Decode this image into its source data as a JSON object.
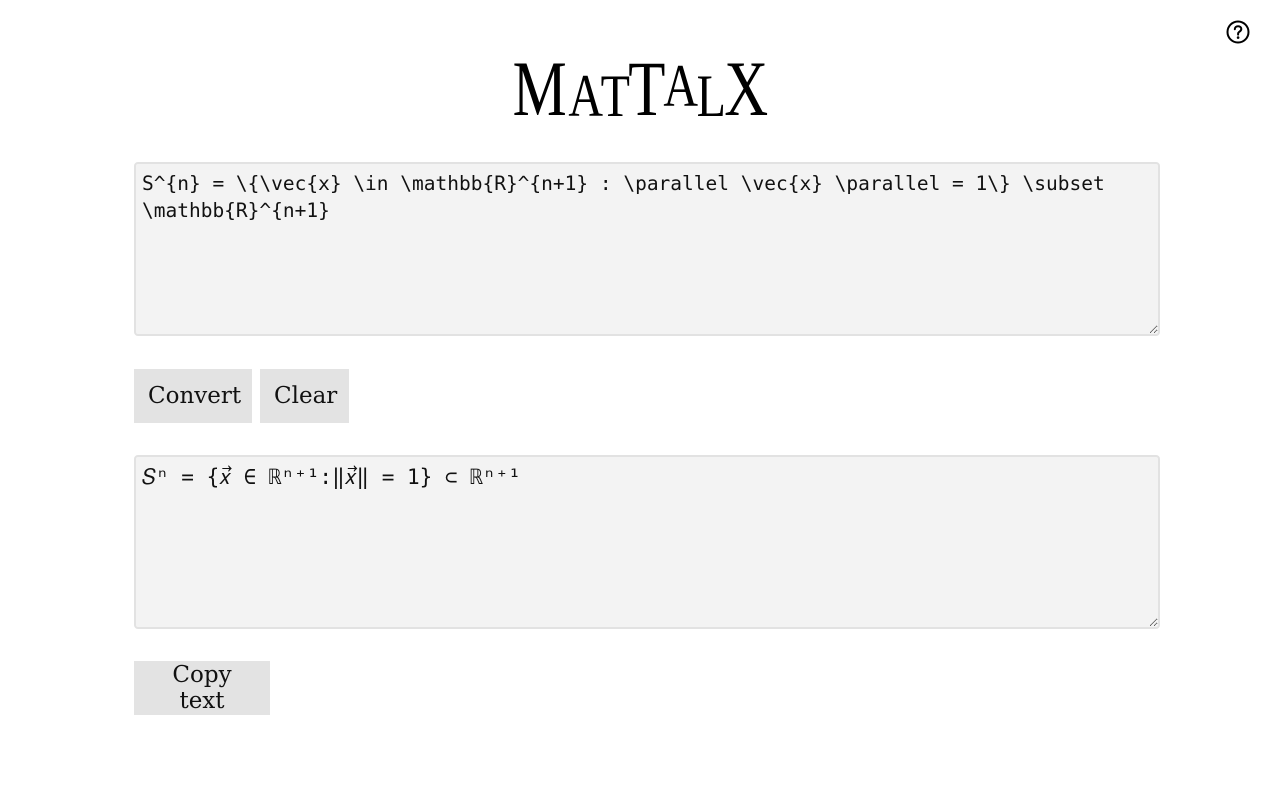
{
  "app": {
    "logo_letters": [
      "M",
      "A",
      "T",
      "T",
      "A",
      "L",
      "X"
    ],
    "help_icon": "question-circle-icon"
  },
  "input": {
    "value": "S^{n} = \\{\\vec{x} \\in \\mathbb{R}^{n+1} : \\parallel \\vec{x} \\parallel = 1\\} \\subset \\mathbb{R}^{n+1}"
  },
  "buttons": {
    "convert_label": "Convert",
    "clear_label": "Clear",
    "copy_label": "Copy text"
  },
  "output": {
    "value": "𝑆ⁿ = {𝑥⃗ ∈ ℝⁿ⁺¹:‖𝑥⃗‖ = 1} ⊂ ℝⁿ⁺¹"
  }
}
